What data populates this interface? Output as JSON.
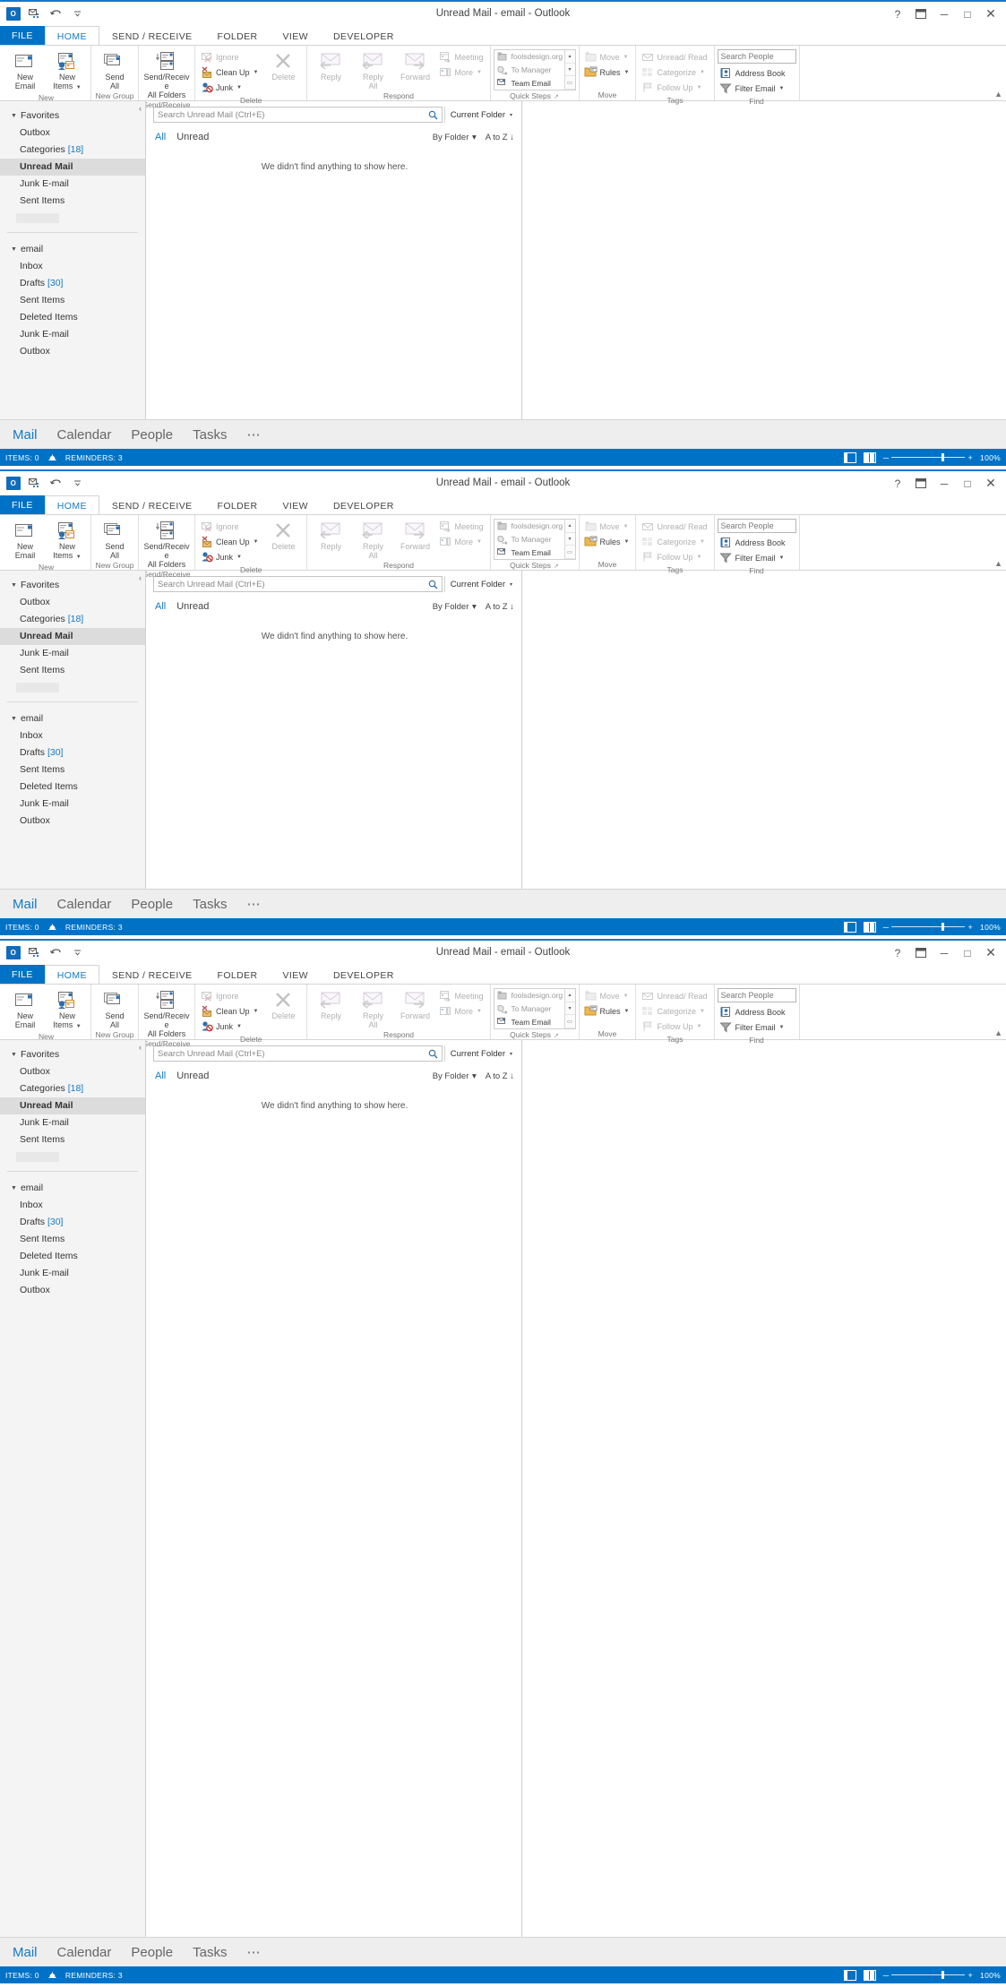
{
  "window": {
    "title": "Unread Mail - email - Outlook",
    "quick_access": [
      "outlook-logo-icon",
      "send-receive-icon",
      "undo-icon",
      "customize-qat-icon"
    ],
    "controls": {
      "help": "?",
      "ribbon_options": "restore-icon",
      "minimize": "─",
      "maximize": "□",
      "close": "✕"
    }
  },
  "ribbon": {
    "tabs": [
      {
        "label": "FILE",
        "active": false,
        "is_file": true
      },
      {
        "label": "HOME",
        "active": true
      },
      {
        "label": "SEND / RECEIVE",
        "active": false
      },
      {
        "label": "FOLDER",
        "active": false
      },
      {
        "label": "VIEW",
        "active": false
      },
      {
        "label": "DEVELOPER",
        "active": false
      }
    ],
    "collapse_label": "▲",
    "groups": {
      "new": {
        "label": "New",
        "buttons": [
          {
            "label": "New\nEmail",
            "line1": "New",
            "line2": "Email",
            "icon": "new-email-icon"
          },
          {
            "label": "New Items",
            "line1": "New",
            "line2": "Items ▾",
            "icon": "new-items-icon"
          }
        ]
      },
      "new_group": {
        "label": "New Group",
        "buttons": [
          {
            "line1": "Send",
            "line2": "All",
            "icon": "send-all-icon"
          }
        ]
      },
      "send_receive": {
        "label": "Send/Receive",
        "buttons": [
          {
            "line1": "Send/Receive",
            "line2": "All Folders",
            "icon": "send-receive-all-icon"
          }
        ]
      },
      "delete": {
        "label": "Delete",
        "small_buttons": [
          {
            "label": "Ignore",
            "icon": "ignore-icon",
            "disabled": true
          },
          {
            "label": "Clean Up",
            "icon": "clean-up-icon",
            "caret": true,
            "disabled": false
          },
          {
            "label": "Junk",
            "icon": "junk-icon",
            "caret": true,
            "disabled": false
          }
        ],
        "big_buttons": [
          {
            "line1": "Delete",
            "line2": "",
            "icon": "delete-x-icon",
            "disabled": true
          }
        ]
      },
      "respond": {
        "label": "Respond",
        "big_buttons": [
          {
            "line1": "Reply",
            "line2": "",
            "icon": "reply-icon",
            "disabled": true
          },
          {
            "line1": "Reply",
            "line2": "All",
            "icon": "reply-all-icon",
            "disabled": true
          },
          {
            "line1": "Forward",
            "line2": "",
            "icon": "forward-icon",
            "disabled": true
          }
        ],
        "small_buttons": [
          {
            "label": "Meeting",
            "icon": "meeting-icon",
            "disabled": true
          },
          {
            "label": "More",
            "icon": "more-respond-icon",
            "caret": true,
            "disabled": true
          }
        ]
      },
      "quick_steps": {
        "label": "Quick Steps",
        "has_dialog_launcher": true,
        "items": [
          {
            "label": "foolsdesign.org",
            "icon": "move-to-folder-icon",
            "enabled": false
          },
          {
            "label": "To Manager",
            "icon": "to-manager-icon",
            "enabled": false
          },
          {
            "label": "Team Email",
            "icon": "team-email-icon",
            "enabled": true
          }
        ],
        "scroll": {
          "up": "▴",
          "down": "▾",
          "more": "▭"
        }
      },
      "move": {
        "label": "Move",
        "small_buttons": [
          {
            "label": "Move",
            "icon": "move-icon",
            "caret": true,
            "disabled": true
          },
          {
            "label": "Rules",
            "icon": "rules-icon",
            "caret": true,
            "disabled": false
          }
        ]
      },
      "tags": {
        "label": "Tags",
        "small_buttons": [
          {
            "label": "Unread/ Read",
            "icon": "unread-read-icon",
            "disabled": true
          },
          {
            "label": "Categorize",
            "icon": "categorize-icon",
            "caret": true,
            "disabled": true
          },
          {
            "label": "Follow Up",
            "icon": "follow-up-icon",
            "caret": true,
            "disabled": true
          }
        ]
      },
      "find": {
        "label": "Find",
        "search_people_placeholder": "Search People",
        "small_buttons": [
          {
            "label": "Address Book",
            "icon": "address-book-icon",
            "disabled": false
          },
          {
            "label": "Filter Email",
            "icon": "filter-email-icon",
            "caret": true,
            "disabled": false
          }
        ]
      }
    }
  },
  "nav_pane": {
    "collapse_icon": "‹",
    "sections": [
      {
        "header": "Favorites",
        "items": [
          {
            "label": "Outbox",
            "count": "",
            "selected": false
          },
          {
            "label": "Categories",
            "count": "[18]",
            "selected": false
          },
          {
            "label": "Unread Mail",
            "count": "",
            "selected": true
          },
          {
            "label": "Junk E-mail",
            "count": "",
            "selected": false
          },
          {
            "label": "Sent Items",
            "count": "",
            "selected": false
          }
        ],
        "redacted_item": true
      },
      {
        "header": "email",
        "items": [
          {
            "label": "Inbox",
            "count": "",
            "selected": false
          },
          {
            "label": "Drafts",
            "count": "[30]",
            "selected": false
          },
          {
            "label": "Sent Items",
            "count": "",
            "selected": false
          },
          {
            "label": "Deleted Items",
            "count": "",
            "selected": false
          },
          {
            "label": "Junk E-mail",
            "count": "",
            "selected": false
          },
          {
            "label": "Outbox",
            "count": "",
            "selected": false
          }
        ],
        "redacted_item": false
      }
    ]
  },
  "message_list": {
    "search_placeholder": "Search Unread Mail (Ctrl+E)",
    "search_icon": "search-magnifier-icon",
    "scope_label": "Current Folder",
    "scope_caret": "▾",
    "filter_all": "All",
    "filter_unread": "Unread",
    "sort_by": "By Folder",
    "sort_caret": "▾",
    "sort_order": "A to Z",
    "sort_arrow": "↓",
    "empty_message": "We didn't find anything to show here."
  },
  "module_bar": {
    "items": [
      {
        "label": "Mail",
        "active": true
      },
      {
        "label": "Calendar",
        "active": false
      },
      {
        "label": "People",
        "active": false
      },
      {
        "label": "Tasks",
        "active": false
      }
    ],
    "overflow": "⋯"
  },
  "status_bar": {
    "items_label": "ITEMS: 0",
    "reminders_icon": "reminder-bell-icon",
    "reminders_label": "REMINDERS: 3",
    "view_normal_icon": "normal-view-icon",
    "view_reading_icon": "reading-view-icon",
    "zoom_out": "─",
    "zoom_in": "+",
    "zoom_level": "100%"
  },
  "colors": {
    "accent": "#0072c6",
    "tab_active": "#1479c4",
    "link": "#1479c4",
    "selected_bg": "#dcdcdc",
    "window_border": "#1278cb"
  }
}
